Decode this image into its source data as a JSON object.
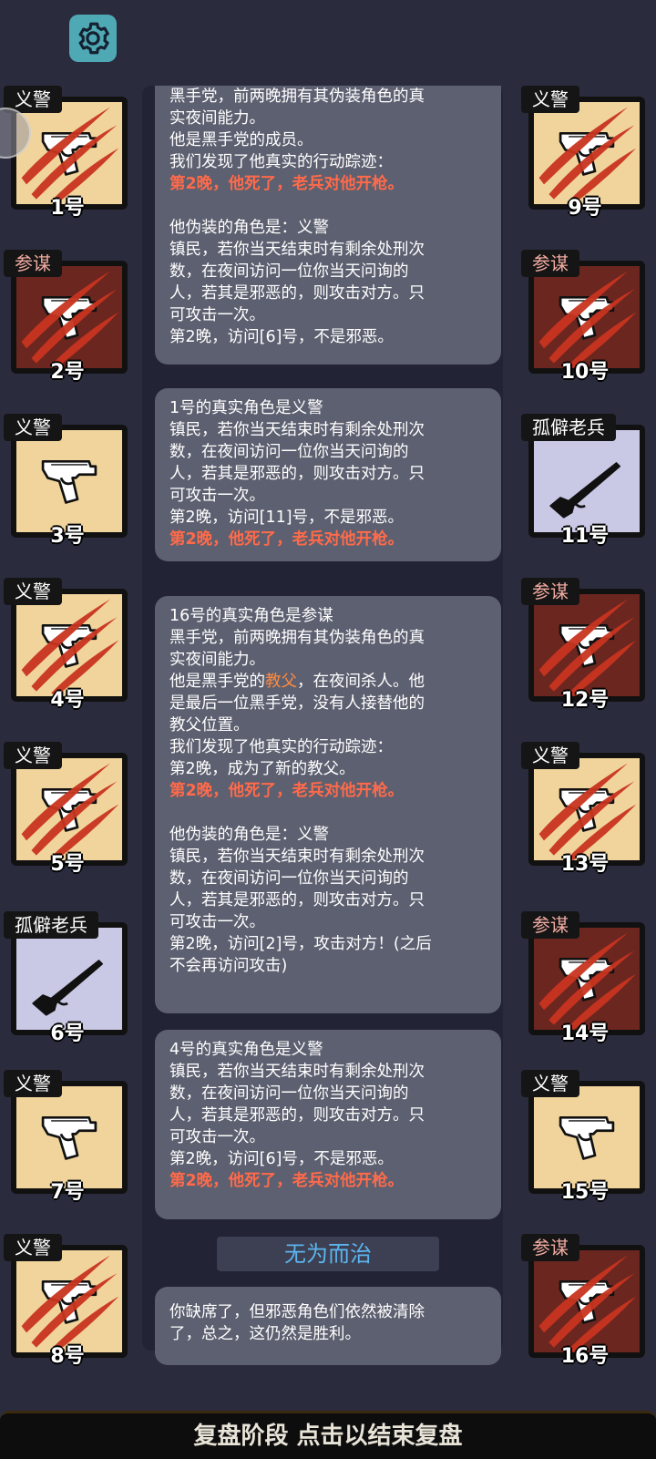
{
  "settings": {
    "icon": "gear-icon"
  },
  "players": [
    {
      "role": "义警",
      "number": "1号",
      "art": "pistol",
      "slashed": true,
      "evil": false
    },
    {
      "role": "参谋",
      "number": "2号",
      "art": "pistol",
      "slashed": true,
      "evil": true
    },
    {
      "role": "义警",
      "number": "3号",
      "art": "pistol",
      "slashed": false,
      "evil": false
    },
    {
      "role": "义警",
      "number": "4号",
      "art": "pistol",
      "slashed": true,
      "evil": false
    },
    {
      "role": "义警",
      "number": "5号",
      "art": "pistol",
      "slashed": true,
      "evil": false
    },
    {
      "role": "孤僻老兵",
      "number": "6号",
      "art": "rifle",
      "slashed": false,
      "evil": false
    },
    {
      "role": "义警",
      "number": "7号",
      "art": "pistol",
      "slashed": false,
      "evil": false
    },
    {
      "role": "义警",
      "number": "8号",
      "art": "pistol",
      "slashed": true,
      "evil": false
    },
    {
      "role": "义警",
      "number": "9号",
      "art": "pistol",
      "slashed": true,
      "evil": false
    },
    {
      "role": "参谋",
      "number": "10号",
      "art": "pistol",
      "slashed": true,
      "evil": true
    },
    {
      "role": "孤僻老兵",
      "number": "11号",
      "art": "rifle",
      "slashed": false,
      "evil": false
    },
    {
      "role": "参谋",
      "number": "12号",
      "art": "pistol",
      "slashed": true,
      "evil": true
    },
    {
      "role": "义警",
      "number": "13号",
      "art": "pistol",
      "slashed": true,
      "evil": false
    },
    {
      "role": "参谋",
      "number": "14号",
      "art": "pistol",
      "slashed": true,
      "evil": true
    },
    {
      "role": "义警",
      "number": "15号",
      "art": "pistol",
      "slashed": false,
      "evil": false
    },
    {
      "role": "参谋",
      "number": "16号",
      "art": "pistol",
      "slashed": true,
      "evil": true
    }
  ],
  "log": {
    "m1": {
      "l1": "黑手党，前两晚拥有其伪装角色的真",
      "l2": "实夜间能力。",
      "l3": "他是黑手党的成员。",
      "l4": "我们发现了他真实的行动踪迹：",
      "l5": "第2晚，他死了，老兵对他开枪。",
      "l6": "他伪装的角色是：义警",
      "l7": "镇民，若你当天结束时有剩余处刑次",
      "l8": "数，在夜间访问一位你当天问询的",
      "l9": "人，若其是邪恶的，则攻击对方。只",
      "l10": "可攻击一次。",
      "l11": "第2晚，访问[6]号，不是邪恶。"
    },
    "m2": {
      "l1": "1号的真实角色是义警",
      "l2": "镇民，若你当天结束时有剩余处刑次",
      "l3": "数，在夜间访问一位你当天问询的",
      "l4": "人，若其是邪恶的，则攻击对方。只",
      "l5": "可攻击一次。",
      "l6": "第2晚，访问[11]号，不是邪恶。",
      "l7": "第2晚，他死了，老兵对他开枪。"
    },
    "m3": {
      "l1": "16号的真实角色是参谋",
      "l2": "黑手党，前两晚拥有其伪装角色的真",
      "l3": "实夜间能力。",
      "l4a": "他是黑手党的",
      "l4b": "教父",
      "l4c": "，在夜间杀人。他",
      "l5": "是最后一位黑手党，没有人接替他的",
      "l6": "教父位置。",
      "l7": "我们发现了他真实的行动踪迹：",
      "l8": "第2晚，成为了新的教父。",
      "l9": "第2晚，他死了，老兵对他开枪。",
      "l10": "他伪装的角色是：义警",
      "l11": "镇民，若你当天结束时有剩余处刑次",
      "l12": "数，在夜间访问一位你当天问询的",
      "l13": "人，若其是邪恶的，则攻击对方。只",
      "l14": "可攻击一次。",
      "l15": "第2晚，访问[2]号，攻击对方！(之后",
      "l16": "不会再访问攻击)"
    },
    "m4": {
      "l1": "4号的真实角色是义警",
      "l2": "镇民，若你当天结束时有剩余处刑次",
      "l3": "数，在夜间访问一位你当天问询的",
      "l4": "人，若其是邪恶的，则攻击对方。只",
      "l5": "可攻击一次。",
      "l6": "第2晚，访问[6]号，不是邪恶。",
      "l7": "第2晚，他死了，老兵对他开枪。"
    },
    "result_title": "无为而治",
    "m5": {
      "l1": "你缺席了，但邪恶角色们依然被清除",
      "l2": "了，总之，这仍然是胜利。"
    }
  },
  "bottom_bar": "复盘阶段 点击以结束复盘",
  "colors": {
    "death_text": "#ff6a4a",
    "title_blue": "#5cb4ef",
    "vigilante_bg": "#f1d49c",
    "consigliere_bg": "#6b2620",
    "veteran_bg": "#c9c9e6"
  }
}
